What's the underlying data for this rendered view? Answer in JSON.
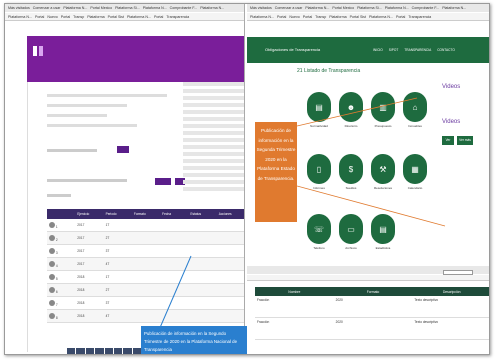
{
  "left_window": {
    "bookmarks": [
      "Más visitados",
      "Comenzar a usar",
      "Plataforma N...",
      "Portal Mexico",
      "Plataforma Si...",
      "Plataforma N...",
      "Comprobante F...",
      "Plataforma N..."
    ],
    "tabs": [
      "Plataforma N...",
      "Portal",
      "Nuevo",
      "Portal",
      "Transp",
      "Plataforma",
      "Portal Sist",
      "Plataforma N...",
      "Portal",
      "Transparencia"
    ],
    "header_title": "",
    "header_subtitle": "",
    "table": {
      "headers": [
        "",
        "Ejercicio",
        "Periodo",
        "Formato",
        "Fecha",
        "Estatus",
        "Acciones"
      ],
      "rows": [
        [
          "1",
          "2017",
          "1T",
          "",
          "",
          "",
          ""
        ],
        [
          "2",
          "2017",
          "2T",
          "",
          "",
          "",
          ""
        ],
        [
          "3",
          "2017",
          "3T",
          "",
          "",
          "",
          ""
        ],
        [
          "4",
          "2017",
          "4T",
          "",
          "",
          "",
          ""
        ],
        [
          "5",
          "2018",
          "1T",
          "",
          "",
          "",
          ""
        ],
        [
          "6",
          "2018",
          "2T",
          "",
          "",
          "",
          ""
        ],
        [
          "7",
          "2018",
          "3T",
          "",
          "",
          "",
          ""
        ],
        [
          "8",
          "2018",
          "4T",
          "",
          "",
          "",
          ""
        ]
      ]
    },
    "annotation": "Publicación de información en la Segundo Trimestre de 2020 en la Plataforma Nacional de Transparencia",
    "colors": {
      "header": "#7a1e9a",
      "table_header": "#3a2a6a",
      "annotation": "#2a7fcf"
    }
  },
  "right_window": {
    "nav_title": "Obligaciones de Transparencia",
    "nav_items": [
      "INICIO",
      "SIPOT",
      "TRANSPARENCIA",
      "CONTACTO"
    ],
    "heading": "21 Listado de Transparencia",
    "icons": [
      {
        "name": "document-icon",
        "caption": "Normatividad"
      },
      {
        "name": "people-icon",
        "caption": "Directorio"
      },
      {
        "name": "chart-icon",
        "caption": "Presupuesto"
      },
      {
        "name": "building-icon",
        "caption": "Inmuebles"
      },
      {
        "name": "book-icon",
        "caption": "Informes"
      },
      {
        "name": "money-icon",
        "caption": "Sueldos"
      },
      {
        "name": "gavel-icon",
        "caption": "Resoluciones"
      },
      {
        "name": "calendar-icon",
        "caption": "Calendario"
      },
      {
        "name": "phone-icon",
        "caption": "Teléfono"
      },
      {
        "name": "file-icon",
        "caption": "Archivos"
      },
      {
        "name": "chart2-icon",
        "caption": "Estadística"
      }
    ],
    "video_title": "Videos",
    "video_subtitle": "Videos",
    "video_buttons": [
      "Ver",
      "Ver más"
    ],
    "annotation": "Publicación de información en la Segunda Trimestre 2020 en la Plataforma Estado de Transparencia.",
    "low_table": {
      "headers": [
        "Nombre",
        "Formato",
        "Descripción"
      ],
      "rows": [
        [
          "Fracción",
          "2020",
          "Texto descriptivo"
        ],
        [
          "Fracción",
          "2020",
          "Texto descriptivo"
        ]
      ]
    },
    "colors": {
      "nav": "#1e6b3f",
      "annotation": "#e07a2f",
      "video": "#6a3aa0"
    }
  }
}
